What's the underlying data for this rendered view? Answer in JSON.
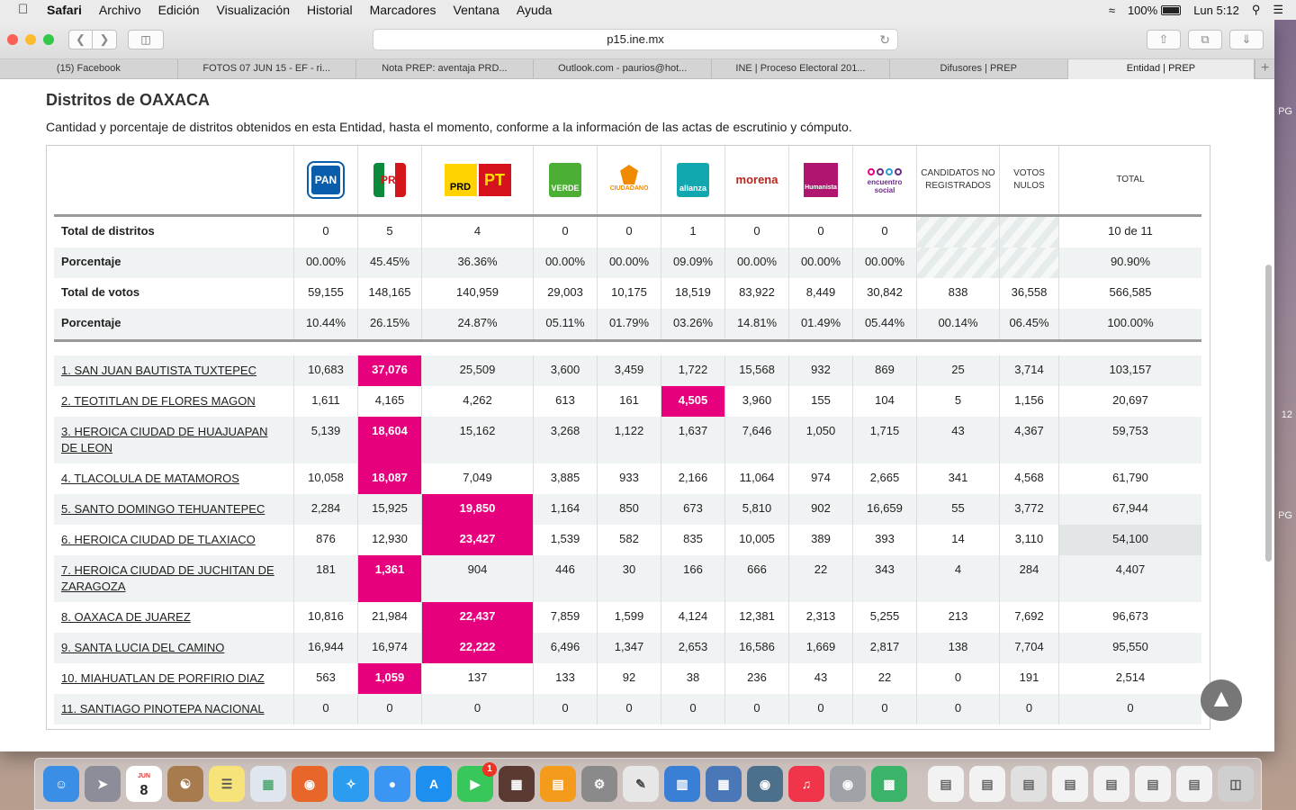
{
  "menubar": {
    "app": "Safari",
    "items": [
      "Archivo",
      "Edición",
      "Visualización",
      "Historial",
      "Marcadores",
      "Ventana",
      "Ayuda"
    ],
    "battery": "100%",
    "clock": "Lun 5:12"
  },
  "browser": {
    "url": "p15.ine.mx",
    "tabs": [
      "(15) Facebook",
      "FOTOS 07 JUN 15 - EF - ri...",
      "Nota PREP: aventaja PRD...",
      "Outlook.com - paurios@hot...",
      "INE | Proceso Electoral 201...",
      "Difusores | PREP",
      "Entidad | PREP"
    ],
    "active_tab": 6
  },
  "page": {
    "title": "Distritos de OAXACA",
    "description": "Cantidad y porcentaje de distritos obtenidos en esta Entidad, hasta el momento, conforme a la información de las actas de escrutinio y cómputo."
  },
  "parties": [
    {
      "key": "pan",
      "label": "PAN"
    },
    {
      "key": "pri",
      "label": "PRI"
    },
    {
      "key": "prd_pt",
      "label": "PRD PT"
    },
    {
      "key": "verde",
      "label": "VERDE"
    },
    {
      "key": "mc",
      "label": "MOVIMIENTO CIUDADANO"
    },
    {
      "key": "na",
      "label": "nueva alianza"
    },
    {
      "key": "morena",
      "label": "morena"
    },
    {
      "key": "hum",
      "label": "Humanista"
    },
    {
      "key": "es",
      "label": "encuentro social"
    }
  ],
  "headers": {
    "cnr": "CANDIDATOS NO REGISTRADOS",
    "nulos": "VOTOS NULOS",
    "total": "TOTAL"
  },
  "summary": [
    {
      "label": "Total de distritos",
      "values": [
        "0",
        "5",
        "4",
        "0",
        "0",
        "1",
        "0",
        "0",
        "0",
        "",
        "",
        "10 de 11"
      ]
    },
    {
      "label": "Porcentaje",
      "values": [
        "00.00%",
        "45.45%",
        "36.36%",
        "00.00%",
        "00.00%",
        "09.09%",
        "00.00%",
        "00.00%",
        "00.00%",
        "",
        "",
        "90.90%"
      ]
    },
    {
      "label": "Total de votos",
      "values": [
        "59,155",
        "148,165",
        "140,959",
        "29,003",
        "10,175",
        "18,519",
        "83,922",
        "8,449",
        "30,842",
        "838",
        "36,558",
        "566,585"
      ]
    },
    {
      "label": "Porcentaje",
      "values": [
        "10.44%",
        "26.15%",
        "24.87%",
        "05.11%",
        "01.79%",
        "03.26%",
        "14.81%",
        "01.49%",
        "05.44%",
        "00.14%",
        "06.45%",
        "100.00%"
      ]
    }
  ],
  "districts": [
    {
      "name": "1. SAN JUAN BAUTISTA TUXTEPEC",
      "values": [
        "10,683",
        "37,076",
        "25,509",
        "3,600",
        "3,459",
        "1,722",
        "15,568",
        "932",
        "869",
        "25",
        "3,714",
        "103,157"
      ],
      "winner": 1
    },
    {
      "name": "2. TEOTITLAN DE FLORES MAGON",
      "values": [
        "1,611",
        "4,165",
        "4,262",
        "613",
        "161",
        "4,505",
        "3,960",
        "155",
        "104",
        "5",
        "1,156",
        "20,697"
      ],
      "winner": 5
    },
    {
      "name": "3. HEROICA CIUDAD DE HUAJUAPAN DE LEON",
      "values": [
        "5,139",
        "18,604",
        "15,162",
        "3,268",
        "1,122",
        "1,637",
        "7,646",
        "1,050",
        "1,715",
        "43",
        "4,367",
        "59,753"
      ],
      "winner": 1
    },
    {
      "name": "4. TLACOLULA DE MATAMOROS",
      "values": [
        "10,058",
        "18,087",
        "7,049",
        "3,885",
        "933",
        "2,166",
        "11,064",
        "974",
        "2,665",
        "341",
        "4,568",
        "61,790"
      ],
      "winner": 1
    },
    {
      "name": "5. SANTO DOMINGO TEHUANTEPEC",
      "values": [
        "2,284",
        "15,925",
        "19,850",
        "1,164",
        "850",
        "673",
        "5,810",
        "902",
        "16,659",
        "55",
        "3,772",
        "67,944"
      ],
      "winner": 2
    },
    {
      "name": "6. HEROICA CIUDAD DE TLAXIACO",
      "values": [
        "876",
        "12,930",
        "23,427",
        "1,539",
        "582",
        "835",
        "10,005",
        "389",
        "393",
        "14",
        "3,110",
        "54,100"
      ],
      "winner": 2
    },
    {
      "name": "7. HEROICA CIUDAD DE JUCHITAN DE ZARAGOZA",
      "values": [
        "181",
        "1,361",
        "904",
        "446",
        "30",
        "166",
        "666",
        "22",
        "343",
        "4",
        "284",
        "4,407"
      ],
      "winner": 1
    },
    {
      "name": "8. OAXACA DE JUAREZ",
      "values": [
        "10,816",
        "21,984",
        "22,437",
        "7,859",
        "1,599",
        "4,124",
        "12,381",
        "2,313",
        "5,255",
        "213",
        "7,692",
        "96,673"
      ],
      "winner": 2
    },
    {
      "name": "9. SANTA LUCIA DEL CAMINO",
      "values": [
        "16,944",
        "16,974",
        "22,222",
        "6,496",
        "1,347",
        "2,653",
        "16,586",
        "1,669",
        "2,817",
        "138",
        "7,704",
        "95,550"
      ],
      "winner": 2
    },
    {
      "name": "10. MIAHUATLAN DE PORFIRIO DIAZ",
      "values": [
        "563",
        "1,059",
        "137",
        "133",
        "92",
        "38",
        "236",
        "43",
        "22",
        "0",
        "191",
        "2,514"
      ],
      "winner": 1
    },
    {
      "name": "11. SANTIAGO PINOTEPA NACIONAL",
      "values": [
        "0",
        "0",
        "0",
        "0",
        "0",
        "0",
        "0",
        "0",
        "0",
        "0",
        "0",
        "0"
      ],
      "winner": -1
    }
  ],
  "colors": {
    "winner": "#e6007e"
  },
  "dock": {
    "calendar_day": "8",
    "calendar_month": "JUN",
    "facetime_badge": "1"
  },
  "desktop_edge_labels": [
    "PG",
    "12",
    "PG"
  ]
}
